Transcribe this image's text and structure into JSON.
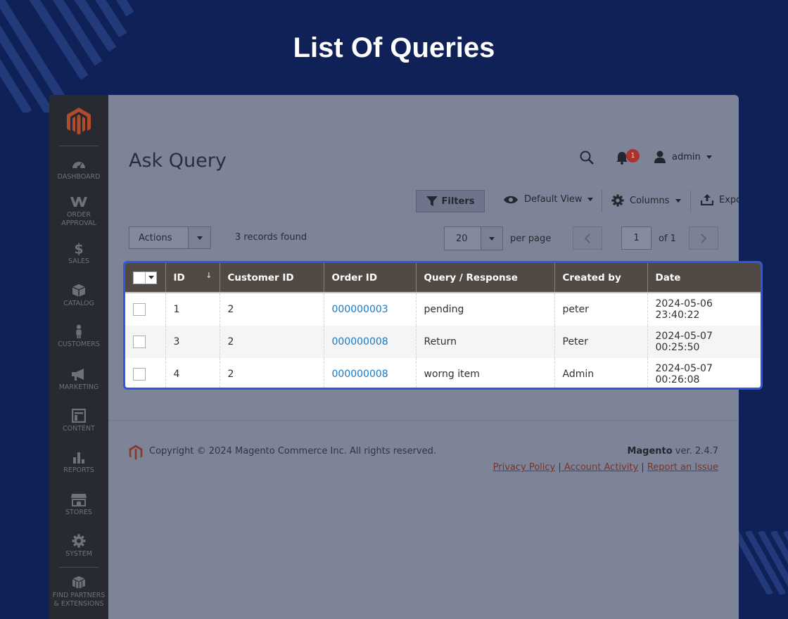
{
  "hero": {
    "title": "List Of Queries"
  },
  "sidebar": {
    "items": [
      {
        "label": "DASHBOARD",
        "icon": "dashboard-icon"
      },
      {
        "label": "ORDER APPROVAL",
        "icon": "order-approval-icon"
      },
      {
        "label": "SALES",
        "icon": "dollar-icon"
      },
      {
        "label": "CATALOG",
        "icon": "box-icon"
      },
      {
        "label": "CUSTOMERS",
        "icon": "person-icon"
      },
      {
        "label": "MARKETING",
        "icon": "megaphone-icon"
      },
      {
        "label": "CONTENT",
        "icon": "layout-icon"
      },
      {
        "label": "REPORTS",
        "icon": "bar-chart-icon"
      },
      {
        "label": "STORES",
        "icon": "storefront-icon"
      },
      {
        "label": "SYSTEM",
        "icon": "gear-icon"
      },
      {
        "label": "FIND PARTNERS & EXTENSIONS",
        "icon": "cubes-icon"
      }
    ]
  },
  "header": {
    "page_title": "Ask Query",
    "notification_count": "1",
    "user_name": "admin"
  },
  "toolbar": {
    "filters_label": "Filters",
    "view_label": "Default View",
    "columns_label": "Columns",
    "export_label": "Export",
    "actions_label": "Actions",
    "records_found": "3 records found",
    "per_page_value": "20",
    "per_page_label": "per page",
    "current_page": "1",
    "of_pages": "of 1"
  },
  "grid": {
    "columns": [
      "ID",
      "Customer ID",
      "Order ID",
      "Query / Response",
      "Created by",
      "Date"
    ],
    "rows": [
      {
        "id": "1",
        "customer_id": "2",
        "order_id": "000000003",
        "query": "pending",
        "created_by": "peter",
        "date": "2024-05-06 23:40:22"
      },
      {
        "id": "3",
        "customer_id": "2",
        "order_id": "000000008",
        "query": "Return",
        "created_by": "Peter",
        "date": "2024-05-07 00:25:50"
      },
      {
        "id": "4",
        "customer_id": "2",
        "order_id": "000000008",
        "query": "worng item",
        "created_by": "Admin",
        "date": "2024-05-07 00:26:08"
      }
    ]
  },
  "footer": {
    "copyright": "Copyright © 2024 Magento Commerce Inc. All rights reserved.",
    "brand": "Magento",
    "version": " ver. 2.4.7",
    "links": [
      "Privacy Policy",
      " Account Activity",
      "Report an Issue"
    ],
    "separator": "|"
  },
  "colors": {
    "background": "#0f2156",
    "header_row": "#514943",
    "highlight_border": "#2f56e0",
    "link": "#1979c3",
    "magento_orange": "#eb5202"
  }
}
